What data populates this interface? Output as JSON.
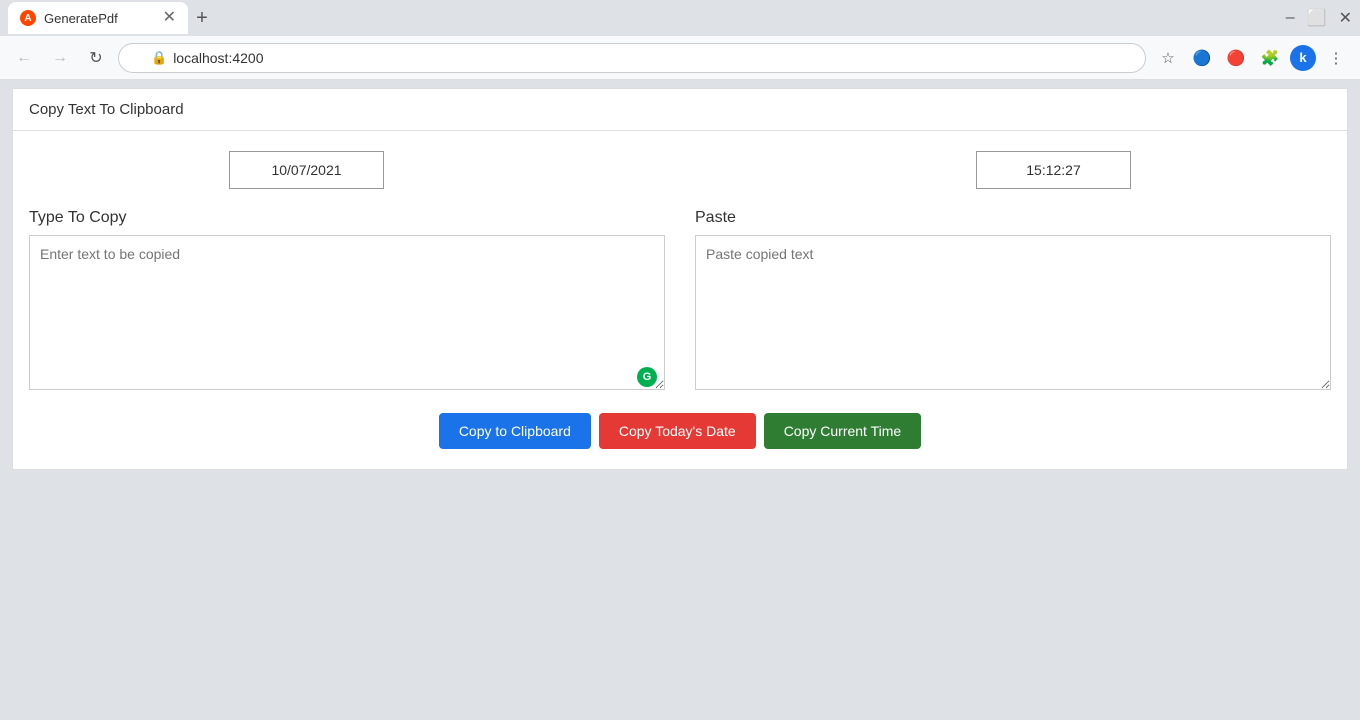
{
  "browser": {
    "tab_title": "GeneratePdf",
    "tab_icon": "A",
    "new_tab_icon": "+",
    "window_controls": {
      "minimize": "–",
      "maximize": "⬜",
      "close": "✕"
    },
    "nav": {
      "back": "←",
      "forward": "→",
      "refresh": "↻",
      "address": "localhost:4200",
      "bookmark": "☆",
      "extensions_label": "extensions",
      "menu": "⋮"
    }
  },
  "page": {
    "header": "Copy Text To Clipboard",
    "date_value": "10/07/2021",
    "time_value": "15:12:27",
    "type_to_copy_label": "Type To Copy",
    "type_placeholder": "Enter text to be copied",
    "paste_label": "Paste",
    "paste_placeholder": "Paste copied text",
    "buttons": {
      "copy_clipboard": "Copy to Clipboard",
      "copy_date": "Copy Today's Date",
      "copy_time": "Copy Current Time"
    }
  }
}
